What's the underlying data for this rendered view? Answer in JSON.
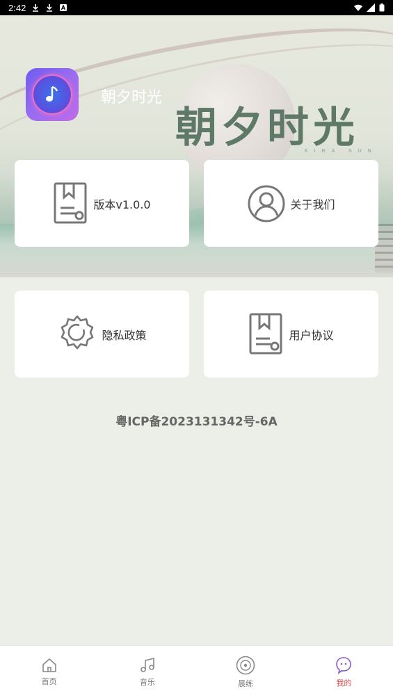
{
  "status_bar": {
    "time": "2:42",
    "icons": [
      "download-icon",
      "download-icon",
      "a-icon",
      "wifi-icon",
      "signal-icon",
      "battery-icon"
    ]
  },
  "header": {
    "app_name": "朝夕时光",
    "banner_title": "朝夕时光",
    "banner_subtitle": "KIRA SUN"
  },
  "cards": [
    {
      "label": "版本v1.0.0",
      "icon": "document-icon"
    },
    {
      "label": "关于我们",
      "icon": "user-circle-icon"
    },
    {
      "label": "隐私政策",
      "icon": "gear-icon"
    },
    {
      "label": "用户协议",
      "icon": "document-icon"
    }
  ],
  "footer_text": "粤ICP备2023131342号-6A",
  "tabbar": {
    "items": [
      {
        "label": "首页",
        "icon": "home-icon"
      },
      {
        "label": "音乐",
        "icon": "music-icon"
      },
      {
        "label": "晨练",
        "icon": "disc-icon"
      },
      {
        "label": "我的",
        "icon": "profile-icon"
      }
    ],
    "active_index": 3
  },
  "colors": {
    "background": "#ebefe7",
    "active_tab": "#e0464a",
    "icon_gray": "#777777"
  }
}
